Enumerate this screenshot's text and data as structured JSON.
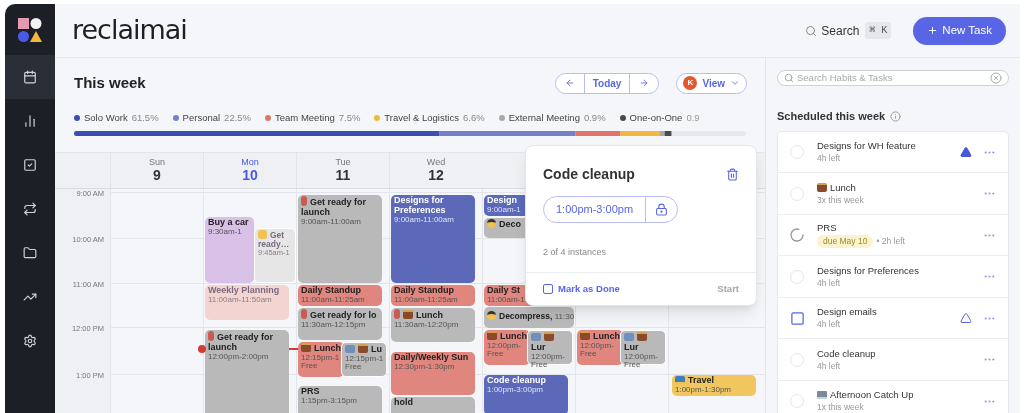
{
  "header": {
    "logo": "reclaimai",
    "search": {
      "label": "Search",
      "shortcut": "⌘ K"
    },
    "new_task": "New Task"
  },
  "sidebar": {
    "items": [
      {
        "selected": true
      },
      {
        "selected": false
      },
      {
        "selected": false
      },
      {
        "selected": false
      },
      {
        "selected": false
      },
      {
        "selected": false
      },
      {
        "selected": false
      }
    ]
  },
  "week": {
    "title": "This week",
    "nav": {
      "today": "Today"
    },
    "view": {
      "avatar": "K",
      "label": "View"
    },
    "legend": [
      {
        "label": "Solo Work",
        "share": "61.5%",
        "color": "#3b4db0"
      },
      {
        "label": "Personal",
        "share": "22.5%",
        "color": "#7480c8"
      },
      {
        "label": "Team Meeting",
        "share": "7.5%",
        "color": "#e07468"
      },
      {
        "label": "Travel & Logistics",
        "share": "6.6%",
        "color": "#f0b840"
      },
      {
        "label": "External Meeting",
        "share": "0.9%",
        "color": "#a8a8a8"
      },
      {
        "label": "One-on-One",
        "share": "0.9",
        "color": "#4a4a4a"
      }
    ]
  },
  "calendar": {
    "days": [
      {
        "weekday": "Sun",
        "date": "9",
        "selected": false
      },
      {
        "weekday": "Mon",
        "date": "10",
        "selected": true
      },
      {
        "weekday": "Tue",
        "date": "11",
        "selected": false
      },
      {
        "weekday": "Wed",
        "date": "12",
        "selected": false
      }
    ],
    "time_labels": [
      "9:00 AM",
      "10:00 AM",
      "11:00 AM",
      "12:00 PM",
      "1:00 PM"
    ],
    "events": [
      {
        "title": "Buy a car",
        "time": "9:30am-1",
        "color": "#d9c0e6"
      },
      {
        "title": "Get ready…",
        "time": "9:45am-1",
        "color": "#e6e6e6"
      },
      {
        "title": "Weekly Planning",
        "time": "11:00am-11:50am",
        "color": "#f4d4d1"
      },
      {
        "title": "Get ready for launch",
        "time": "12:00pm-2:00pm",
        "color": "#b9b9b9"
      },
      {
        "title": "Get ready for launch",
        "time": "9:00am-11:00am",
        "color": "#b9b9b9"
      },
      {
        "title": "Daily Standup",
        "time": "11:00am-11:25am",
        "color": "#e0867e"
      },
      {
        "title": "Get ready for lo",
        "time": "11:30am-12:15pm",
        "color": "#b9b9b9"
      },
      {
        "title": "Lunch",
        "time": "12:15pm-1",
        "free": "Free",
        "color": "#e0867e"
      },
      {
        "title": "Lu",
        "time": "12:15pm-1",
        "free": "Free",
        "color": "#b9b9b9"
      },
      {
        "title": "PRS",
        "time": "1:15pm-3:15pm",
        "color": "#b9b9b9"
      },
      {
        "title": "Designs for Preferences",
        "time": "9:00am-11:00am",
        "color": "#5c69b8"
      },
      {
        "title": "Daily Standup",
        "time": "11:00am-11:25am",
        "color": "#e0867e"
      },
      {
        "title": "Lunch",
        "time": "11:30am-12:20pm",
        "color": "#b9b9b9"
      },
      {
        "title": "Daily/Weekly Sun",
        "time": "12:30pm-1:30pm",
        "color": "#e0867e"
      },
      {
        "title": "hold",
        "color": "#b9b9b9"
      },
      {
        "title": "Design",
        "time": "9:00am-1",
        "color": "#5c69b8"
      },
      {
        "title": "Deco",
        "color": "#b9b9b9"
      },
      {
        "title": "Daily St",
        "time": "11:00am-1",
        "color": "#e0867e"
      },
      {
        "title": "Decompress,",
        "time": "11:30",
        "color": "#b9b9b9"
      },
      {
        "title": "Lunch",
        "time": "12:00pm-",
        "free": "Free",
        "color": "#e0867e"
      },
      {
        "title": "Lur",
        "time": "12:00pm-",
        "free": "Free",
        "color": "#b9b9b9"
      },
      {
        "title": "Code cleanup",
        "time": "1:00pm-3:00pm",
        "color": "#5c69b8"
      },
      {
        "title": "Lunch",
        "time": "12:00pm-",
        "free": "Free",
        "color": "#e0867e"
      },
      {
        "title": "Lur",
        "time": "12:00pm-",
        "free": "Free",
        "color": "#b9b9b9"
      },
      {
        "title": "Travel",
        "time": "1:00pm-1:30pm",
        "color": "#f2c65e"
      }
    ]
  },
  "popover": {
    "title": "Code cleanup",
    "time": "1:00pm-3:00pm",
    "instances": "2 of 4 instances",
    "mark_done": {
      "label": "Mark as Done",
      "checked": false
    },
    "start": {
      "label": "Start",
      "disabled": true
    }
  },
  "panel": {
    "search": {
      "placeholder": "Search Habits & Tasks"
    },
    "title": "Scheduled this week",
    "tasks": [
      {
        "title": "Designs for WH feature",
        "meta": "4h left",
        "kind": "circle",
        "priority": {
          "kind": "high"
        }
      },
      {
        "title": "Lunch",
        "meta": "3x this week",
        "kind": "circle"
      },
      {
        "title": "PRS",
        "due": "due May 10",
        "meta": "• 2h left",
        "kind": "progress"
      },
      {
        "title": "Designs for Preferences",
        "meta": "4h left",
        "kind": "circle"
      },
      {
        "title": "Design emails",
        "meta": "4h left",
        "kind": "square",
        "priority": {
          "kind": "low"
        }
      },
      {
        "title": "Code cleanup",
        "meta": "4h left",
        "kind": "circle"
      },
      {
        "title": "Afternoon Catch Up",
        "meta": "1x this week",
        "kind": "circle"
      }
    ]
  }
}
